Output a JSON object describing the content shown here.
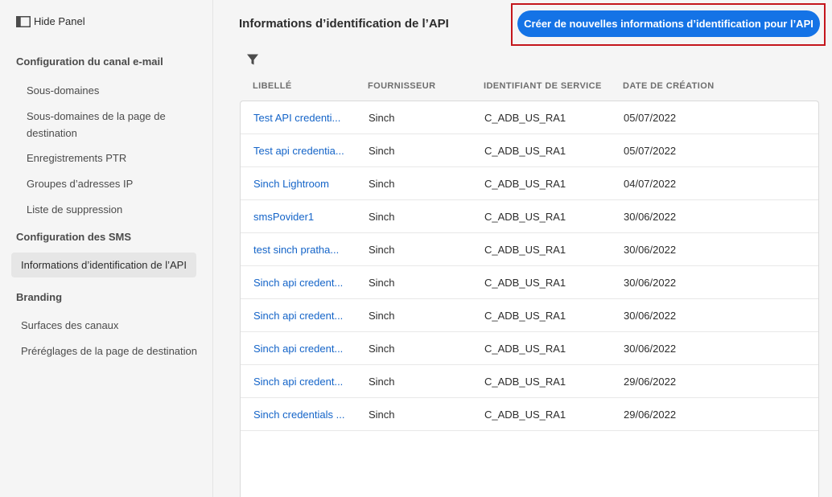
{
  "sidebar": {
    "hide_panel_label": "Hide Panel",
    "email_section": {
      "heading": "Configuration du canal e-mail",
      "items": [
        {
          "label": "Sous-domaines"
        },
        {
          "label": "Sous-domaines de la page de destination"
        },
        {
          "label": "Enregistrements PTR"
        },
        {
          "label": "Groupes d’adresses IP"
        },
        {
          "label": "Liste de suppression"
        }
      ]
    },
    "sms_section": {
      "heading": "Configuration des SMS",
      "items": [
        {
          "label": "Informations d’identification  de l’API",
          "active": true
        }
      ]
    },
    "branding_section": {
      "heading": "Branding",
      "items": [
        {
          "label": "Surfaces des canaux"
        },
        {
          "label": "Préréglages de la page de  destination"
        }
      ]
    }
  },
  "main": {
    "title": "Informations d’identification de l’API",
    "create_button_label": "Créer de nouvelles informations d’identification pour l’API",
    "accent_color": "#1473e6",
    "highlight_color": "#c4161c",
    "columns": [
      "LIBELLÉ",
      "FOURNISSEUR",
      "IDENTIFIANT DE SERVICE",
      "DATE DE CRÉATION"
    ],
    "rows": [
      {
        "label": "Test API credenti...",
        "provider": "Sinch",
        "service_id": "C_ADB_US_RA1",
        "created": "05/07/2022"
      },
      {
        "label": "Test api credentia...",
        "provider": "Sinch",
        "service_id": "C_ADB_US_RA1",
        "created": "05/07/2022"
      },
      {
        "label": "Sinch Lightroom",
        "provider": "Sinch",
        "service_id": "C_ADB_US_RA1",
        "created": "04/07/2022"
      },
      {
        "label": "smsPovider1",
        "provider": "Sinch",
        "service_id": "C_ADB_US_RA1",
        "created": "30/06/2022"
      },
      {
        "label": "test sinch pratha...",
        "provider": "Sinch",
        "service_id": "C_ADB_US_RA1",
        "created": "30/06/2022"
      },
      {
        "label": "Sinch api credent...",
        "provider": "Sinch",
        "service_id": "C_ADB_US_RA1",
        "created": "30/06/2022"
      },
      {
        "label": "Sinch api credent...",
        "provider": "Sinch",
        "service_id": "C_ADB_US_RA1",
        "created": "30/06/2022"
      },
      {
        "label": "Sinch api credent...",
        "provider": "Sinch",
        "service_id": "C_ADB_US_RA1",
        "created": "30/06/2022"
      },
      {
        "label": "Sinch api credent...",
        "provider": "Sinch",
        "service_id": "C_ADB_US_RA1",
        "created": "29/06/2022"
      },
      {
        "label": "Sinch credentials ...",
        "provider": "Sinch",
        "service_id": "C_ADB_US_RA1",
        "created": "29/06/2022"
      }
    ]
  }
}
